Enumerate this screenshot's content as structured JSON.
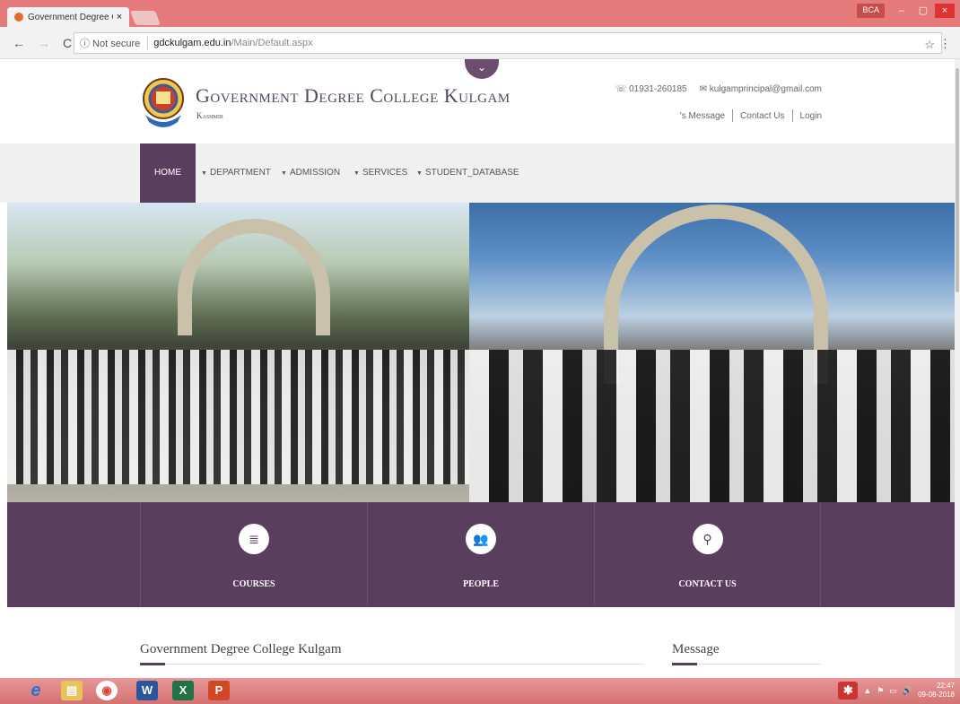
{
  "browser": {
    "tab_title": "Government Degree Coll",
    "tab_close": "×",
    "user_badge": "BCA",
    "secure_label": "ⓘ Not secure",
    "url_host": "gdckulgam.edu.in",
    "url_path": "/Main/Default.aspx",
    "win_min": "–",
    "win_max": "▢",
    "win_close": "×"
  },
  "header": {
    "title": "Government Degree College Kulgam",
    "subtitle": "Kashmir",
    "phone": "01931-260185",
    "email": "kulgamprincipal@gmail.com",
    "links": [
      "'s Message",
      "Contact Us",
      "Login"
    ]
  },
  "nav": {
    "items": [
      "HOME",
      "DEPARTMENT",
      "ADMISSION",
      "SERVICES",
      "STUDENT_DATABASE"
    ]
  },
  "features": [
    {
      "label": "COURSES",
      "icon": "≣"
    },
    {
      "label": "PEOPLE",
      "icon": "👥"
    },
    {
      "label": "CONTACT US",
      "icon": "⚲"
    }
  ],
  "sections": {
    "left_title": "Government Degree College Kulgam",
    "right_title": "Message"
  },
  "taskbar": {
    "time": "22:47",
    "date": "09-08-2018"
  },
  "colors": {
    "brand_purple": "#5a3e5d",
    "tab_bar": "#e47a7a"
  }
}
